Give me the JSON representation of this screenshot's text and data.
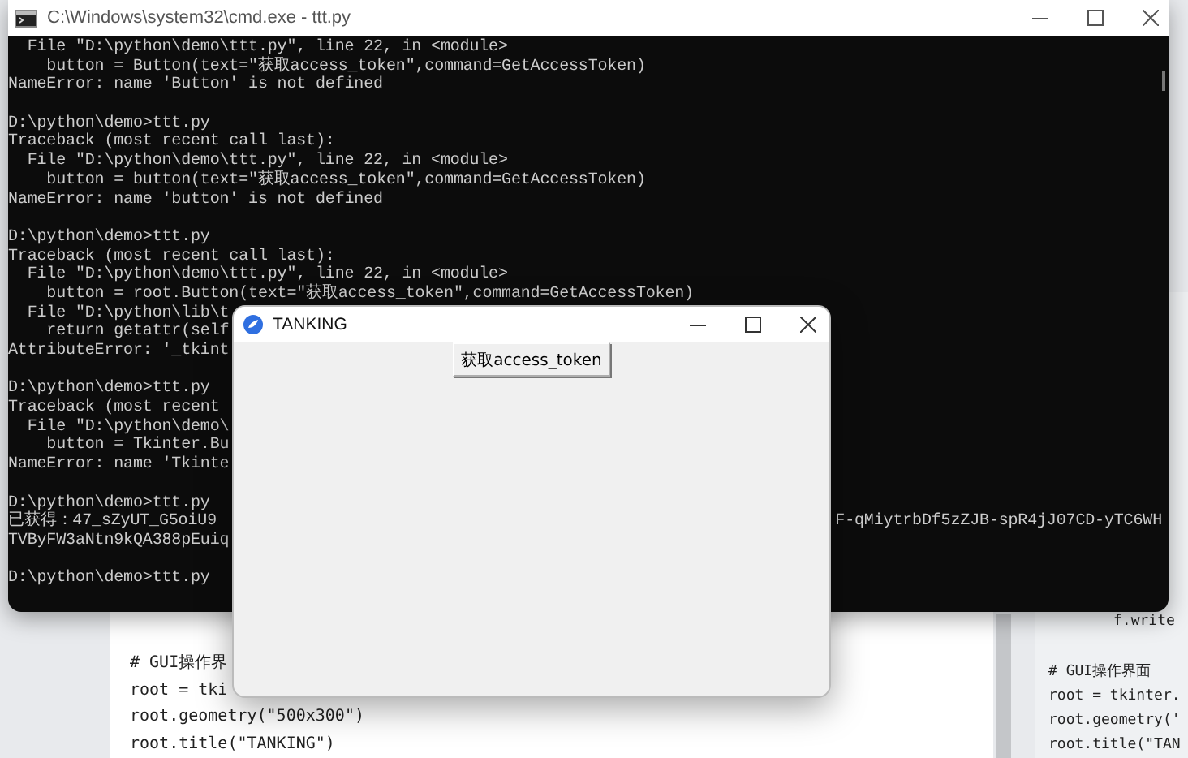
{
  "editor_left": {
    "lines": [
      "# GUI操作界",
      "root = tki",
      "root.geometry(\"500x300\")",
      "root.title(\"TANKING\")"
    ]
  },
  "editor_right": {
    "blocks": [
      [
        "f.write"
      ],
      [
        "# GUI操作界面",
        "root = tkinter.",
        "root.geometry('",
        "root.title(\"TAN"
      ]
    ]
  },
  "terminal": {
    "title": "C:\\Windows\\system32\\cmd.exe - ttt.py",
    "blocks": [
      [
        {
          "text": "  File \"D:\\python\\demo\\ttt.py\", line 22, in <module>"
        },
        {
          "text": "    button = Button(text=\"获取access_token\",command=GetAccessToken)"
        },
        {
          "text": "NameError: name 'Button' is not defined"
        }
      ],
      [
        {
          "text": "D:\\python\\demo>ttt.py"
        },
        {
          "text": "Traceback (most recent call last):"
        },
        {
          "text": "  File \"D:\\python\\demo\\ttt.py\", line 22, in <module>"
        },
        {
          "text": "    button = button(text=\"获取access_token\",command=GetAccessToken)"
        },
        {
          "text": "NameError: name 'button' is not defined"
        }
      ],
      [
        {
          "text": "D:\\python\\demo>ttt.py"
        },
        {
          "text": "Traceback (most recent call last):"
        },
        {
          "text": "  File \"D:\\python\\demo\\ttt.py\", line 22, in <module>"
        },
        {
          "text": "    button = root.Button(text=\"获取access_token\",command=GetAccessToken)"
        },
        {
          "text": "  File \"D:\\python\\lib\\t"
        },
        {
          "text": "    return getattr(self"
        },
        {
          "text": "AttributeError: '_tkint"
        }
      ],
      [
        {
          "text": "D:\\python\\demo>ttt.py"
        },
        {
          "text": "Traceback (most recent"
        },
        {
          "text": "  File \"D:\\python\\demo\\"
        },
        {
          "text": "    button = Tkinter.Bu"
        },
        {
          "text": "NameError: name 'Tkinte"
        }
      ],
      [
        {
          "text": "D:\\python\\demo>ttt.py"
        },
        {
          "text": "已获得：47_sZyUT_G5oiU9",
          "right": "F-qMiytrbDf5zZJB-spR4jJ07CD-yTC6WH"
        },
        {
          "text": "TVByFW3aNtn9kQA388pEuiq"
        }
      ],
      [
        {
          "text": "D:\\python\\demo>ttt.py"
        }
      ]
    ]
  },
  "dialog": {
    "title": "TANKING",
    "button": "获取access_token"
  }
}
